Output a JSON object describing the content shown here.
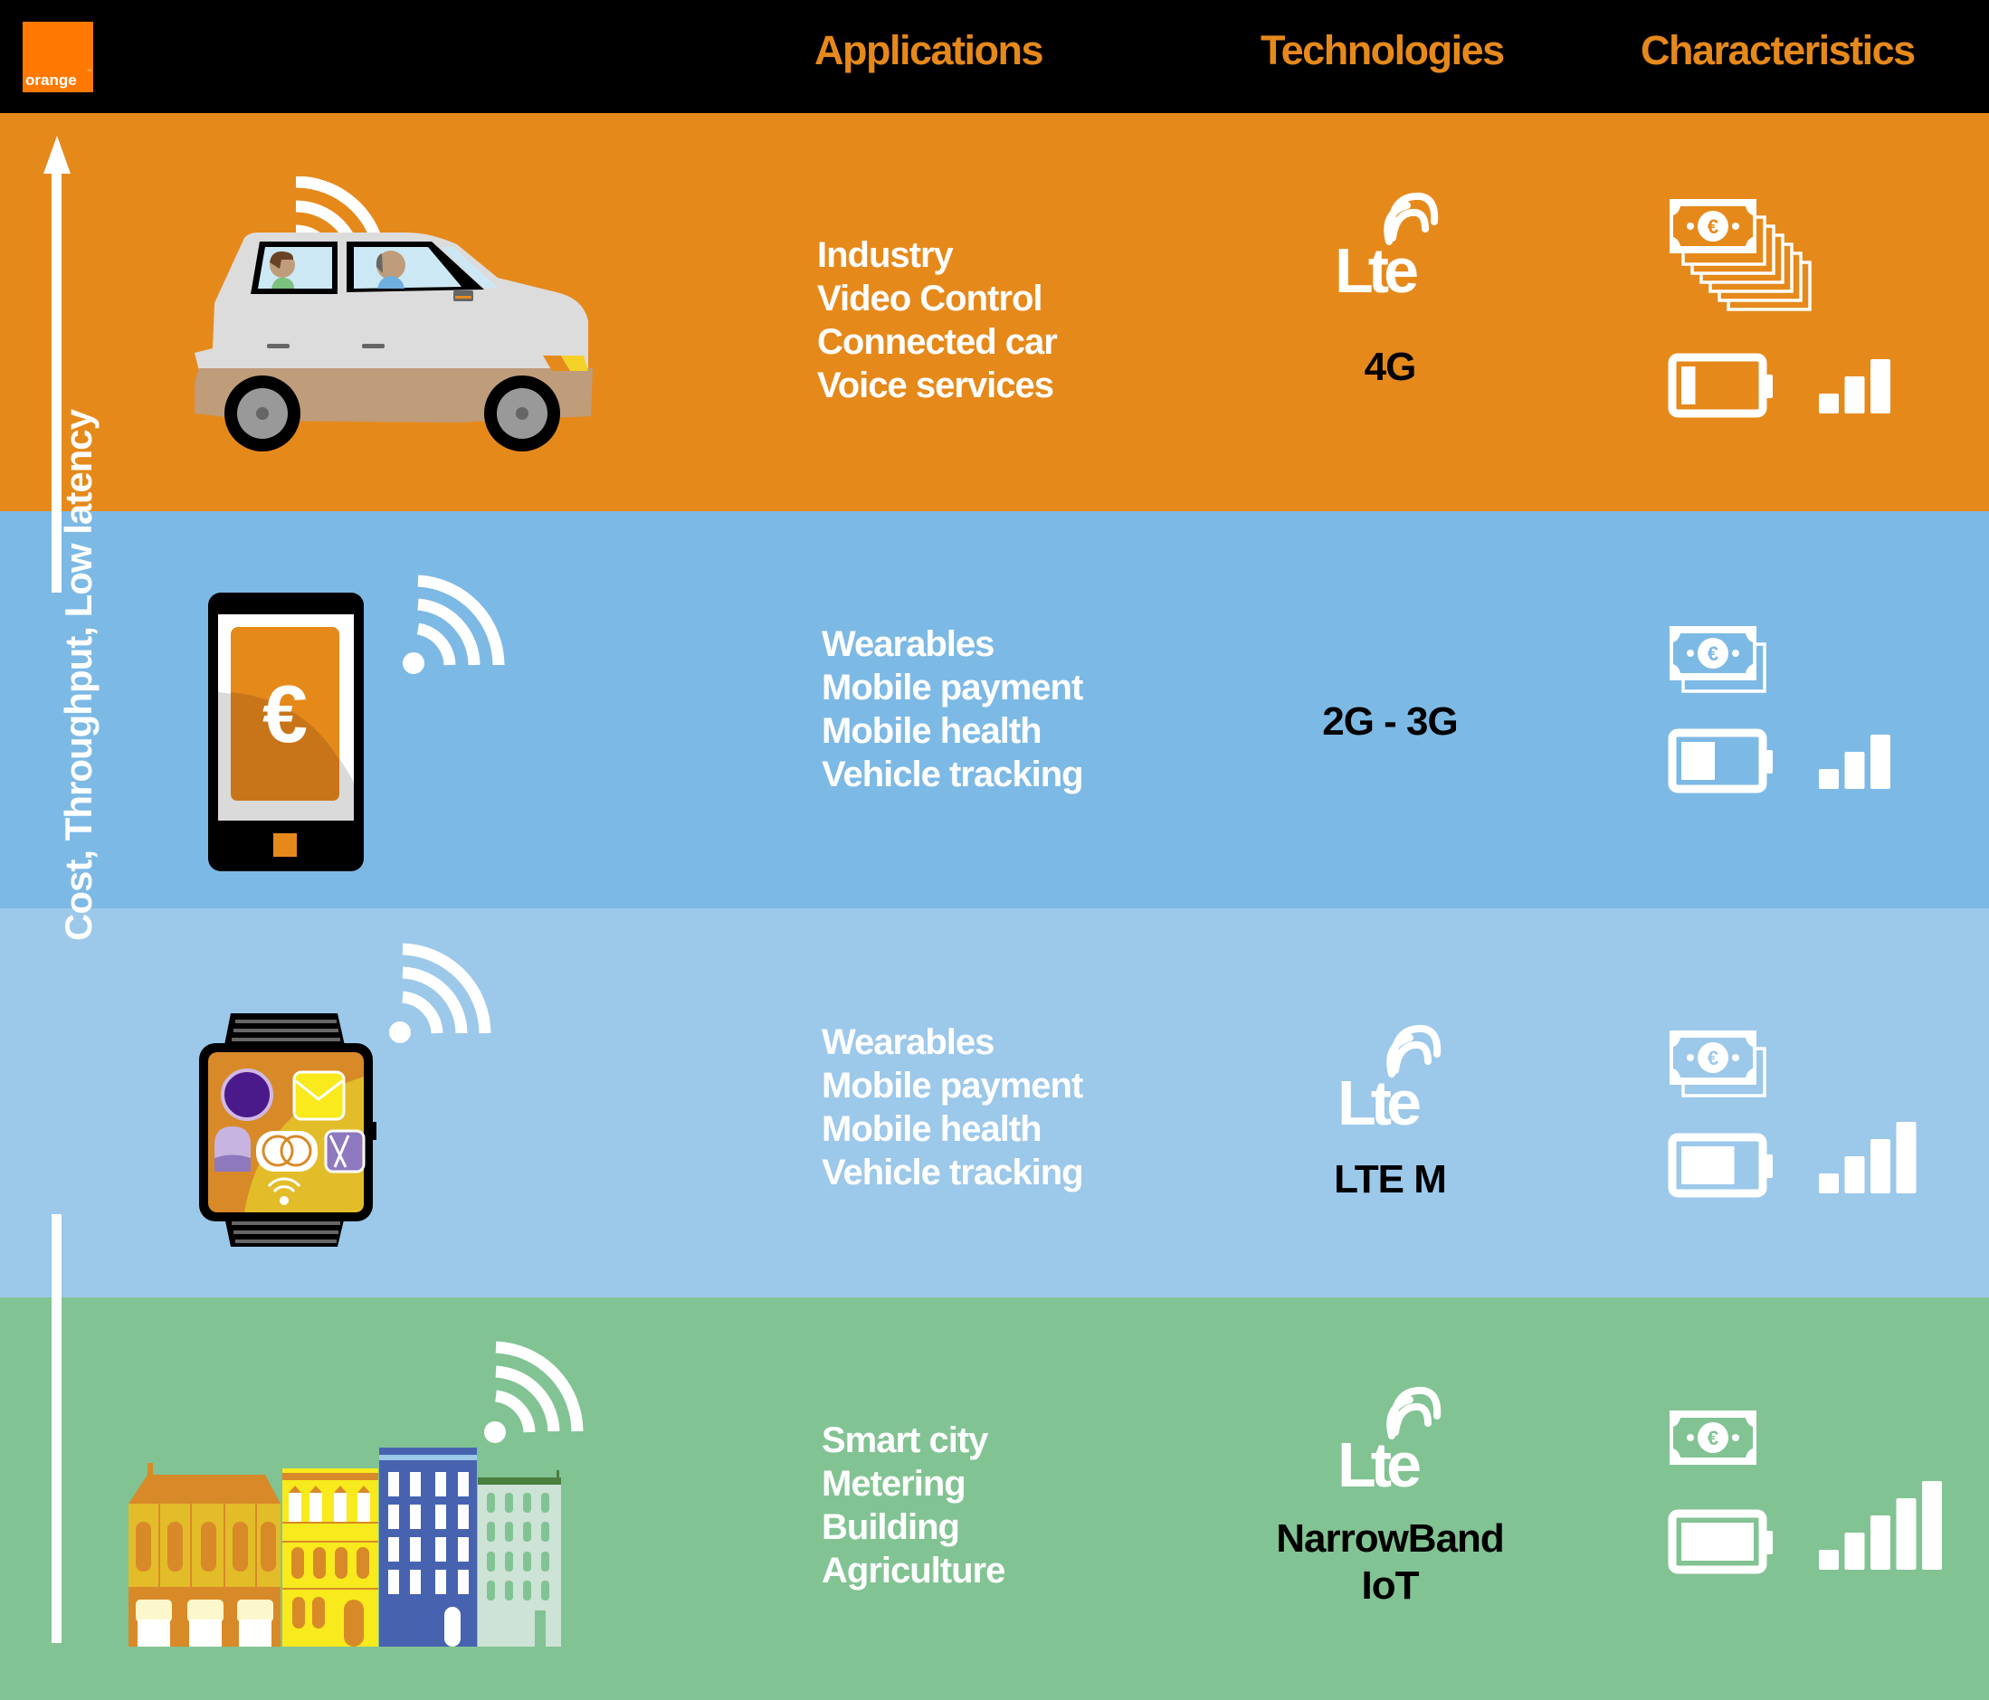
{
  "brand": {
    "logo_text": "orange",
    "trademark": "™"
  },
  "header": {
    "columns": [
      "Applications",
      "Technologies",
      "Characteristics"
    ]
  },
  "axis": {
    "label": "Cost, Throughput, Low latency",
    "direction": "up"
  },
  "colors": {
    "header_bg": "#000000",
    "header_text": "#E6891B",
    "brand_orange": "#FF7900",
    "row1_bg": "#E6891B",
    "row2_bg": "#7DB9E5",
    "row3_bg": "#9CC8EA",
    "row4_bg": "#82C393"
  },
  "rows": [
    {
      "illustration": "connected-car",
      "applications": [
        "Industry",
        "Video Control",
        "Connected car",
        "Voice services"
      ],
      "technology": {
        "logo": "lte-logo",
        "label": "4G",
        "label2": ""
      },
      "characteristics": {
        "cost_banknotes": 7,
        "battery_level": 0.25,
        "signal_bars": 3
      }
    },
    {
      "illustration": "smartphone-payment",
      "applications": [
        "Wearables",
        "Mobile payment",
        "Mobile health",
        "Vehicle tracking"
      ],
      "technology": {
        "logo": "",
        "label": "2G - 3G",
        "label2": ""
      },
      "characteristics": {
        "cost_banknotes": 2,
        "battery_level": 0.5,
        "signal_bars": 3
      }
    },
    {
      "illustration": "smartwatch",
      "applications": [
        "Wearables",
        "Mobile payment",
        "Mobile health",
        "Vehicle tracking"
      ],
      "technology": {
        "logo": "lte-logo",
        "label": "LTE M",
        "label2": ""
      },
      "characteristics": {
        "cost_banknotes": 2,
        "battery_level": 0.75,
        "signal_bars": 4
      }
    },
    {
      "illustration": "smart-city-buildings",
      "applications": [
        "Smart city",
        "Metering",
        "Building",
        "Agriculture"
      ],
      "technology": {
        "logo": "lte-logo",
        "label": "NarrowBand",
        "label2": "IoT"
      },
      "characteristics": {
        "cost_banknotes": 1,
        "battery_level": 1.0,
        "signal_bars": 5
      }
    }
  ]
}
